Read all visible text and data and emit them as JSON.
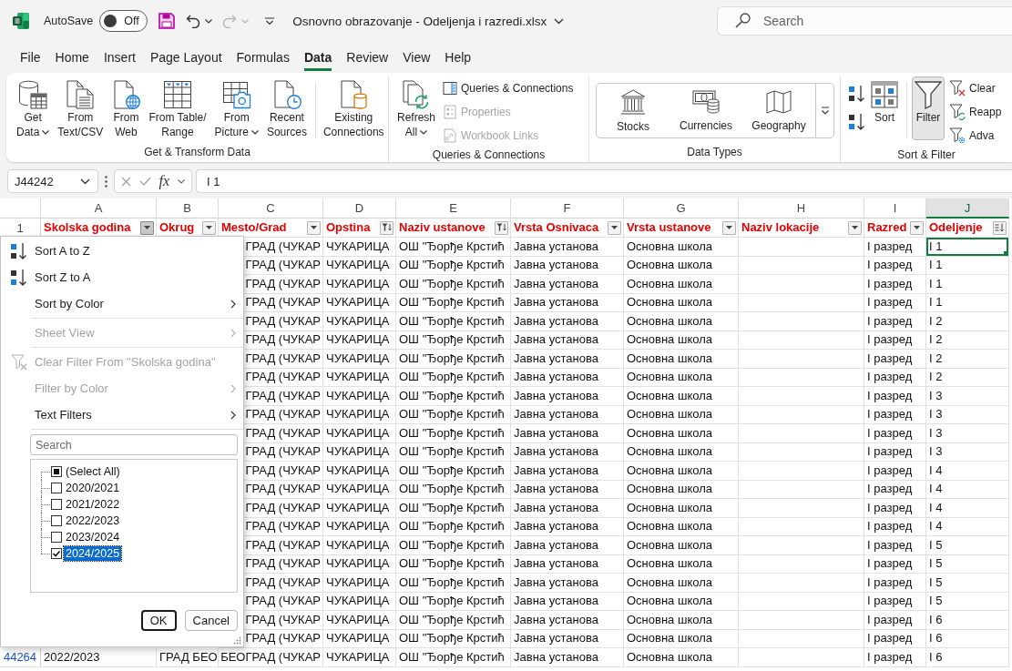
{
  "title_bar": {
    "autosave_label": "AutoSave",
    "autosave_toggle": {
      "label": "Off",
      "on": false
    },
    "quick_access": [
      {
        "kind": "save",
        "disabled": false
      },
      {
        "kind": "undo",
        "disabled": false
      },
      {
        "kind": "redo",
        "disabled": true
      }
    ],
    "title": "Osnovno obrazovanje - Odeljenja i razredi.xlsx",
    "search": {
      "placeholder": "Search"
    }
  },
  "tabs": [
    {
      "label": "File",
      "selected": false
    },
    {
      "label": "Home",
      "selected": false
    },
    {
      "label": "Insert",
      "selected": false
    },
    {
      "label": "Page Layout",
      "selected": false
    },
    {
      "label": "Formulas",
      "selected": false
    },
    {
      "label": "Data",
      "selected": true
    },
    {
      "label": "Review",
      "selected": false
    },
    {
      "label": "View",
      "selected": false
    },
    {
      "label": "Help",
      "selected": false
    }
  ],
  "ribbon": {
    "get_transform": {
      "label": "Get & Transform Data",
      "items": [
        {
          "kind": "button",
          "lines": [
            "Get",
            "Data"
          ],
          "dropdown": true
        },
        {
          "kind": "button",
          "lines": [
            "From",
            "Text/CSV"
          ],
          "dropdown": false
        },
        {
          "kind": "button",
          "lines": [
            "From",
            "Web"
          ],
          "dropdown": false
        },
        {
          "kind": "button",
          "lines": [
            "From Table/",
            "Range"
          ],
          "dropdown": false
        },
        {
          "kind": "button",
          "lines": [
            "From",
            "Picture"
          ],
          "dropdown": true
        },
        {
          "kind": "button",
          "lines": [
            "Recent",
            "Sources"
          ],
          "dropdown": false
        },
        {
          "kind": "separator"
        },
        {
          "kind": "button",
          "lines": [
            "Existing",
            "Connections"
          ],
          "dropdown": false
        }
      ]
    },
    "queries": {
      "label": "Queries & Connections",
      "refresh": {
        "lines": [
          "Refresh",
          "All"
        ],
        "dropdown": true
      },
      "links": [
        {
          "label": "Queries & Connections",
          "disabled": false
        },
        {
          "label": "Properties",
          "disabled": true
        },
        {
          "label": "Workbook Links",
          "disabled": true
        }
      ]
    },
    "data_types": {
      "label": "Data Types",
      "types": [
        {
          "label": "Stocks"
        },
        {
          "label": "Currencies"
        },
        {
          "label": "Geography"
        }
      ]
    },
    "sort_filter": {
      "label": "Sort & Filter",
      "sort": {
        "label": "Sort"
      },
      "filter": {
        "label": "Filter",
        "selected": true
      },
      "links": [
        {
          "label": "Clear",
          "disabled": false
        },
        {
          "label": "Reapp",
          "disabled": false
        },
        {
          "label": "Adva",
          "disabled": false
        }
      ]
    }
  },
  "formula_bar": {
    "name_box": "J44242",
    "function_label": "fx",
    "formula": "I 1"
  },
  "sheet": {
    "columns": [
      {
        "letter": "A",
        "selected": false
      },
      {
        "letter": "B",
        "selected": false
      },
      {
        "letter": "C",
        "selected": false
      },
      {
        "letter": "D",
        "selected": false
      },
      {
        "letter": "E",
        "selected": false
      },
      {
        "letter": "F",
        "selected": false
      },
      {
        "letter": "G",
        "selected": false
      },
      {
        "letter": "H",
        "selected": false
      },
      {
        "letter": "I",
        "selected": false
      },
      {
        "letter": "J",
        "selected": true
      }
    ],
    "header_row": {
      "number": "1",
      "titles": [
        {
          "text": "Skolska godina",
          "filter_open": true,
          "filtered": false,
          "sorted": false
        },
        {
          "text": "Okrug",
          "filter_open": false,
          "filtered": false,
          "sorted": false
        },
        {
          "text": "Mesto/Grad",
          "filter_open": false,
          "filtered": false,
          "sorted": false
        },
        {
          "text": "Opstina",
          "filter_open": false,
          "filtered": true,
          "sorted": false
        },
        {
          "text": "Naziv ustanove",
          "filter_open": false,
          "filtered": true,
          "sorted": false
        },
        {
          "text": "Vrsta Osnivaca",
          "filter_open": false,
          "filtered": false,
          "sorted": false
        },
        {
          "text": "Vrsta ustanove",
          "filter_open": false,
          "filtered": false,
          "sorted": false
        },
        {
          "text": "Naziv lokacije",
          "filter_open": false,
          "filtered": false,
          "sorted": false
        },
        {
          "text": "Razred",
          "filter_open": false,
          "filtered": false,
          "sorted": false
        },
        {
          "text": "Odeljenje",
          "filter_open": false,
          "filtered": false,
          "sorted": true
        }
      ]
    },
    "rows": [
      {
        "selected": true,
        "mesto_grad": "ГРАД (ЧУКАР",
        "opstina": "ЧУКАРИЦА",
        "naziv_ustanove": "ОШ \"Ђорђе Крстић",
        "vrsta_osnivaca": "Јавна установа",
        "vrsta_ustanove": "Основна школа",
        "razred": "I разред",
        "odeljenje": "I 1"
      },
      {
        "selected": false,
        "mesto_grad": "ГРАД (ЧУКАР",
        "opstina": "ЧУКАРИЦА",
        "naziv_ustanove": "ОШ \"Ђорђе Крстић",
        "vrsta_osnivaca": "Јавна установа",
        "vrsta_ustanove": "Основна школа",
        "razred": "I разред",
        "odeljenje": "I 1"
      },
      {
        "selected": false,
        "mesto_grad": "ГРАД (ЧУКАР",
        "opstina": "ЧУКАРИЦА",
        "naziv_ustanove": "ОШ \"Ђорђе Крстић",
        "vrsta_osnivaca": "Јавна установа",
        "vrsta_ustanove": "Основна школа",
        "razred": "I разред",
        "odeljenje": "I 1"
      },
      {
        "selected": false,
        "mesto_grad": "ГРАД (ЧУКАР",
        "opstina": "ЧУКАРИЦА",
        "naziv_ustanove": "ОШ \"Ђорђе Крстић",
        "vrsta_osnivaca": "Јавна установа",
        "vrsta_ustanove": "Основна школа",
        "razred": "I разред",
        "odeljenje": "I 1"
      },
      {
        "selected": false,
        "mesto_grad": "ГРАД (ЧУКАР",
        "opstina": "ЧУКАРИЦА",
        "naziv_ustanove": "ОШ \"Ђорђе Крстић",
        "vrsta_osnivaca": "Јавна установа",
        "vrsta_ustanove": "Основна школа",
        "razred": "I разред",
        "odeljenje": "I 2"
      },
      {
        "selected": false,
        "mesto_grad": "ГРАД (ЧУКАР",
        "opstina": "ЧУКАРИЦА",
        "naziv_ustanove": "ОШ \"Ђорђе Крстић",
        "vrsta_osnivaca": "Јавна установа",
        "vrsta_ustanove": "Основна школа",
        "razred": "I разред",
        "odeljenje": "I 2"
      },
      {
        "selected": false,
        "mesto_grad": "ГРАД (ЧУКАР",
        "opstina": "ЧУКАРИЦА",
        "naziv_ustanove": "ОШ \"Ђорђе Крстић",
        "vrsta_osnivaca": "Јавна установа",
        "vrsta_ustanove": "Основна школа",
        "razred": "I разред",
        "odeljenje": "I 2"
      },
      {
        "selected": false,
        "mesto_grad": "ГРАД (ЧУКАР",
        "opstina": "ЧУКАРИЦА",
        "naziv_ustanove": "ОШ \"Ђорђе Крстић",
        "vrsta_osnivaca": "Јавна установа",
        "vrsta_ustanove": "Основна школа",
        "razred": "I разред",
        "odeljenje": "I 2"
      },
      {
        "selected": false,
        "mesto_grad": "ГРАД (ЧУКАР",
        "opstina": "ЧУКАРИЦА",
        "naziv_ustanove": "ОШ \"Ђорђе Крстић",
        "vrsta_osnivaca": "Јавна установа",
        "vrsta_ustanove": "Основна школа",
        "razred": "I разред",
        "odeljenje": "I 3"
      },
      {
        "selected": false,
        "mesto_grad": "ГРАД (ЧУКАР",
        "opstina": "ЧУКАРИЦА",
        "naziv_ustanove": "ОШ \"Ђорђе Крстић",
        "vrsta_osnivaca": "Јавна установа",
        "vrsta_ustanove": "Основна школа",
        "razred": "I разред",
        "odeljenje": "I 3"
      },
      {
        "selected": false,
        "mesto_grad": "ГРАД (ЧУКАР",
        "opstina": "ЧУКАРИЦА",
        "naziv_ustanove": "ОШ \"Ђорђе Крстић",
        "vrsta_osnivaca": "Јавна установа",
        "vrsta_ustanove": "Основна школа",
        "razred": "I разред",
        "odeljenje": "I 3"
      },
      {
        "selected": false,
        "mesto_grad": "ГРАД (ЧУКАР",
        "opstina": "ЧУКАРИЦА",
        "naziv_ustanove": "ОШ \"Ђорђе Крстић",
        "vrsta_osnivaca": "Јавна установа",
        "vrsta_ustanove": "Основна школа",
        "razred": "I разред",
        "odeljenje": "I 3"
      },
      {
        "selected": false,
        "mesto_grad": "ГРАД (ЧУКАР",
        "opstina": "ЧУКАРИЦА",
        "naziv_ustanove": "ОШ \"Ђорђе Крстић",
        "vrsta_osnivaca": "Јавна установа",
        "vrsta_ustanove": "Основна школа",
        "razred": "I разред",
        "odeljenje": "I 4"
      },
      {
        "selected": false,
        "mesto_grad": "ГРАД (ЧУКАР",
        "opstina": "ЧУКАРИЦА",
        "naziv_ustanove": "ОШ \"Ђорђе Крстић",
        "vrsta_osnivaca": "Јавна установа",
        "vrsta_ustanove": "Основна школа",
        "razred": "I разред",
        "odeljenje": "I 4"
      },
      {
        "selected": false,
        "mesto_grad": "ГРАД (ЧУКАР",
        "opstina": "ЧУКАРИЦА",
        "naziv_ustanove": "ОШ \"Ђорђе Крстић",
        "vrsta_osnivaca": "Јавна установа",
        "vrsta_ustanove": "Основна школа",
        "razred": "I разред",
        "odeljenje": "I 4"
      },
      {
        "selected": false,
        "mesto_grad": "ГРАД (ЧУКАР",
        "opstina": "ЧУКАРИЦА",
        "naziv_ustanove": "ОШ \"Ђорђе Крстић",
        "vrsta_osnivaca": "Јавна установа",
        "vrsta_ustanove": "Основна школа",
        "razred": "I разред",
        "odeljenje": "I 4"
      },
      {
        "selected": false,
        "mesto_grad": "ГРАД (ЧУКАР",
        "opstina": "ЧУКАРИЦА",
        "naziv_ustanove": "ОШ \"Ђорђе Крстић",
        "vrsta_osnivaca": "Јавна установа",
        "vrsta_ustanove": "Основна школа",
        "razred": "I разред",
        "odeljenje": "I 5"
      },
      {
        "selected": false,
        "mesto_grad": "ГРАД (ЧУКАР",
        "opstina": "ЧУКАРИЦА",
        "naziv_ustanove": "ОШ \"Ђорђе Крстић",
        "vrsta_osnivaca": "Јавна установа",
        "vrsta_ustanove": "Основна школа",
        "razred": "I разред",
        "odeljenje": "I 5"
      },
      {
        "selected": false,
        "mesto_grad": "ГРАД (ЧУКАР",
        "opstina": "ЧУКАРИЦА",
        "naziv_ustanove": "ОШ \"Ђорђе Крстић",
        "vrsta_osnivaca": "Јавна установа",
        "vrsta_ustanove": "Основна школа",
        "razred": "I разред",
        "odeljenje": "I 5"
      },
      {
        "selected": false,
        "mesto_grad": "ГРАД (ЧУКАР",
        "opstina": "ЧУКАРИЦА",
        "naziv_ustanove": "ОШ \"Ђорђе Крстић",
        "vrsta_osnivaca": "Јавна установа",
        "vrsta_ustanove": "Основна школа",
        "razred": "I разред",
        "odeljenje": "I 5"
      },
      {
        "selected": false,
        "mesto_grad": "ГРАД (ЧУКАР",
        "opstina": "ЧУКАРИЦА",
        "naziv_ustanove": "ОШ \"Ђорђе Крстић",
        "vrsta_osnivaca": "Јавна установа",
        "vrsta_ustanove": "Основна школа",
        "razred": "I разред",
        "odeljenje": "I 6"
      },
      {
        "selected": false,
        "mesto_grad": "ГРАД (ЧУКАР",
        "opstina": "ЧУКАРИЦА",
        "naziv_ustanove": "ОШ \"Ђорђе Крстић",
        "vrsta_osnivaca": "Јавна установа",
        "vrsta_ustanove": "Основна школа",
        "razred": "I разред",
        "odeljenje": "I 6"
      },
      {
        "selected": false,
        "row_number": "44264",
        "skolska_godina": "2022/2023",
        "okrug": "ГРАД БЕО",
        "mesto_grad": "БЕОГРАД (ЧУКАР",
        "opstina": "ЧУКАРИЦА",
        "naziv_ustanove": "ОШ \"Ђорђе Крстић",
        "vrsta_osnivaca": "Јавна установа",
        "vrsta_ustanove": "Основна школа",
        "razred": "I разред",
        "odeljenje": "I 6"
      }
    ]
  },
  "filter_menu": {
    "items": [
      {
        "kind": "ascending",
        "label": "Sort A to Z",
        "disabled": false,
        "submenu": false
      },
      {
        "kind": "descending",
        "label": "Sort Z to A",
        "disabled": false,
        "submenu": false
      },
      {
        "kind": "plain",
        "label": "Sort by Color",
        "disabled": false,
        "submenu": true
      },
      {
        "kind": "separator"
      },
      {
        "kind": "plain",
        "label": "Sheet View",
        "disabled": true,
        "submenu": true
      },
      {
        "kind": "separator"
      },
      {
        "kind": "clear",
        "label": "Clear Filter From \"Skolska godina\"",
        "disabled": true,
        "submenu": false
      },
      {
        "kind": "plain",
        "label": "Filter by Color",
        "disabled": true,
        "submenu": true
      },
      {
        "kind": "plain",
        "label": "Text Filters",
        "disabled": false,
        "submenu": true
      },
      {
        "kind": "separator"
      }
    ],
    "search": {
      "placeholder": "Search"
    },
    "values": [
      {
        "label": "(Select All)",
        "checked": false,
        "indeterminate": true,
        "selected": false
      },
      {
        "label": "2020/2021",
        "checked": false,
        "indeterminate": false,
        "selected": false
      },
      {
        "label": "2021/2022",
        "checked": false,
        "indeterminate": false,
        "selected": false
      },
      {
        "label": "2022/2023",
        "checked": false,
        "indeterminate": false,
        "selected": false
      },
      {
        "label": "2023/2024",
        "checked": false,
        "indeterminate": false,
        "selected": false
      },
      {
        "label": "2024/2025",
        "checked": true,
        "indeterminate": false,
        "selected": true
      }
    ],
    "buttons": [
      {
        "label": "OK",
        "focused": true
      },
      {
        "label": "Cancel",
        "focused": false
      }
    ]
  }
}
